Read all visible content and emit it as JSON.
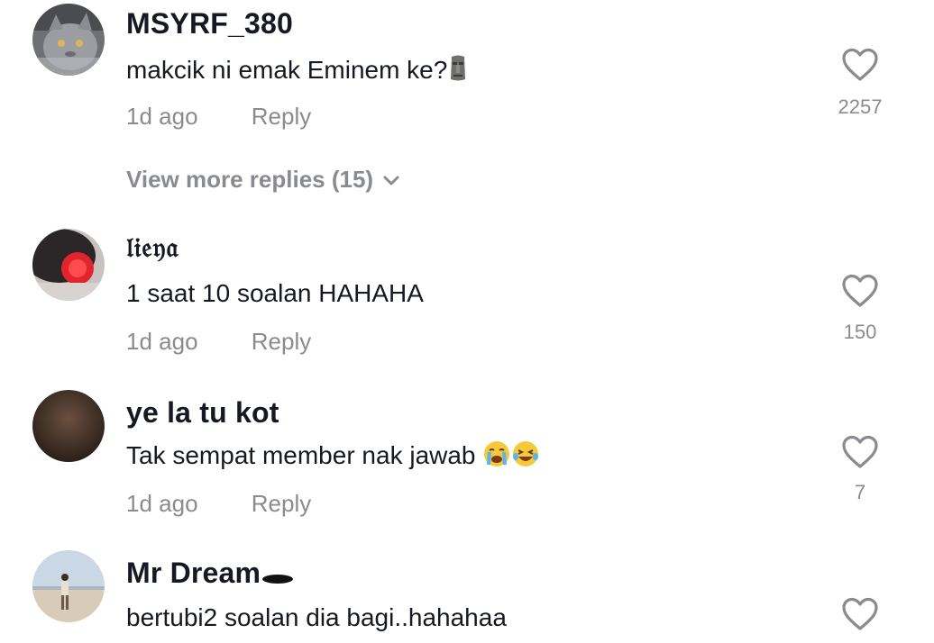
{
  "comments": [
    {
      "username": "MSYRF_380",
      "text": "makcik ni emak Eminem ke?",
      "emoji": "moai",
      "time": "1d ago",
      "reply_label": "Reply",
      "likes": "2257",
      "view_more": "View more replies (15)"
    },
    {
      "username": "𝔩𝔦𝔢𝔶𝔞",
      "text": "1 saat 10 soalan HAHAHA",
      "time": "1d ago",
      "reply_label": "Reply",
      "likes": "150"
    },
    {
      "username": "ye la tu kot",
      "text": "Tak sempat member nak jawab",
      "emoji": "crying-face laughing-face",
      "time": "1d ago",
      "reply_label": "Reply",
      "likes": "7"
    },
    {
      "username": "Mr Dream",
      "emoji": "hole",
      "text": "bertubi2 soalan dia bagi..hahahaa"
    }
  ],
  "colors": {
    "text": "#161823",
    "muted": "#8a8b91",
    "icon": "#8a8b91"
  }
}
